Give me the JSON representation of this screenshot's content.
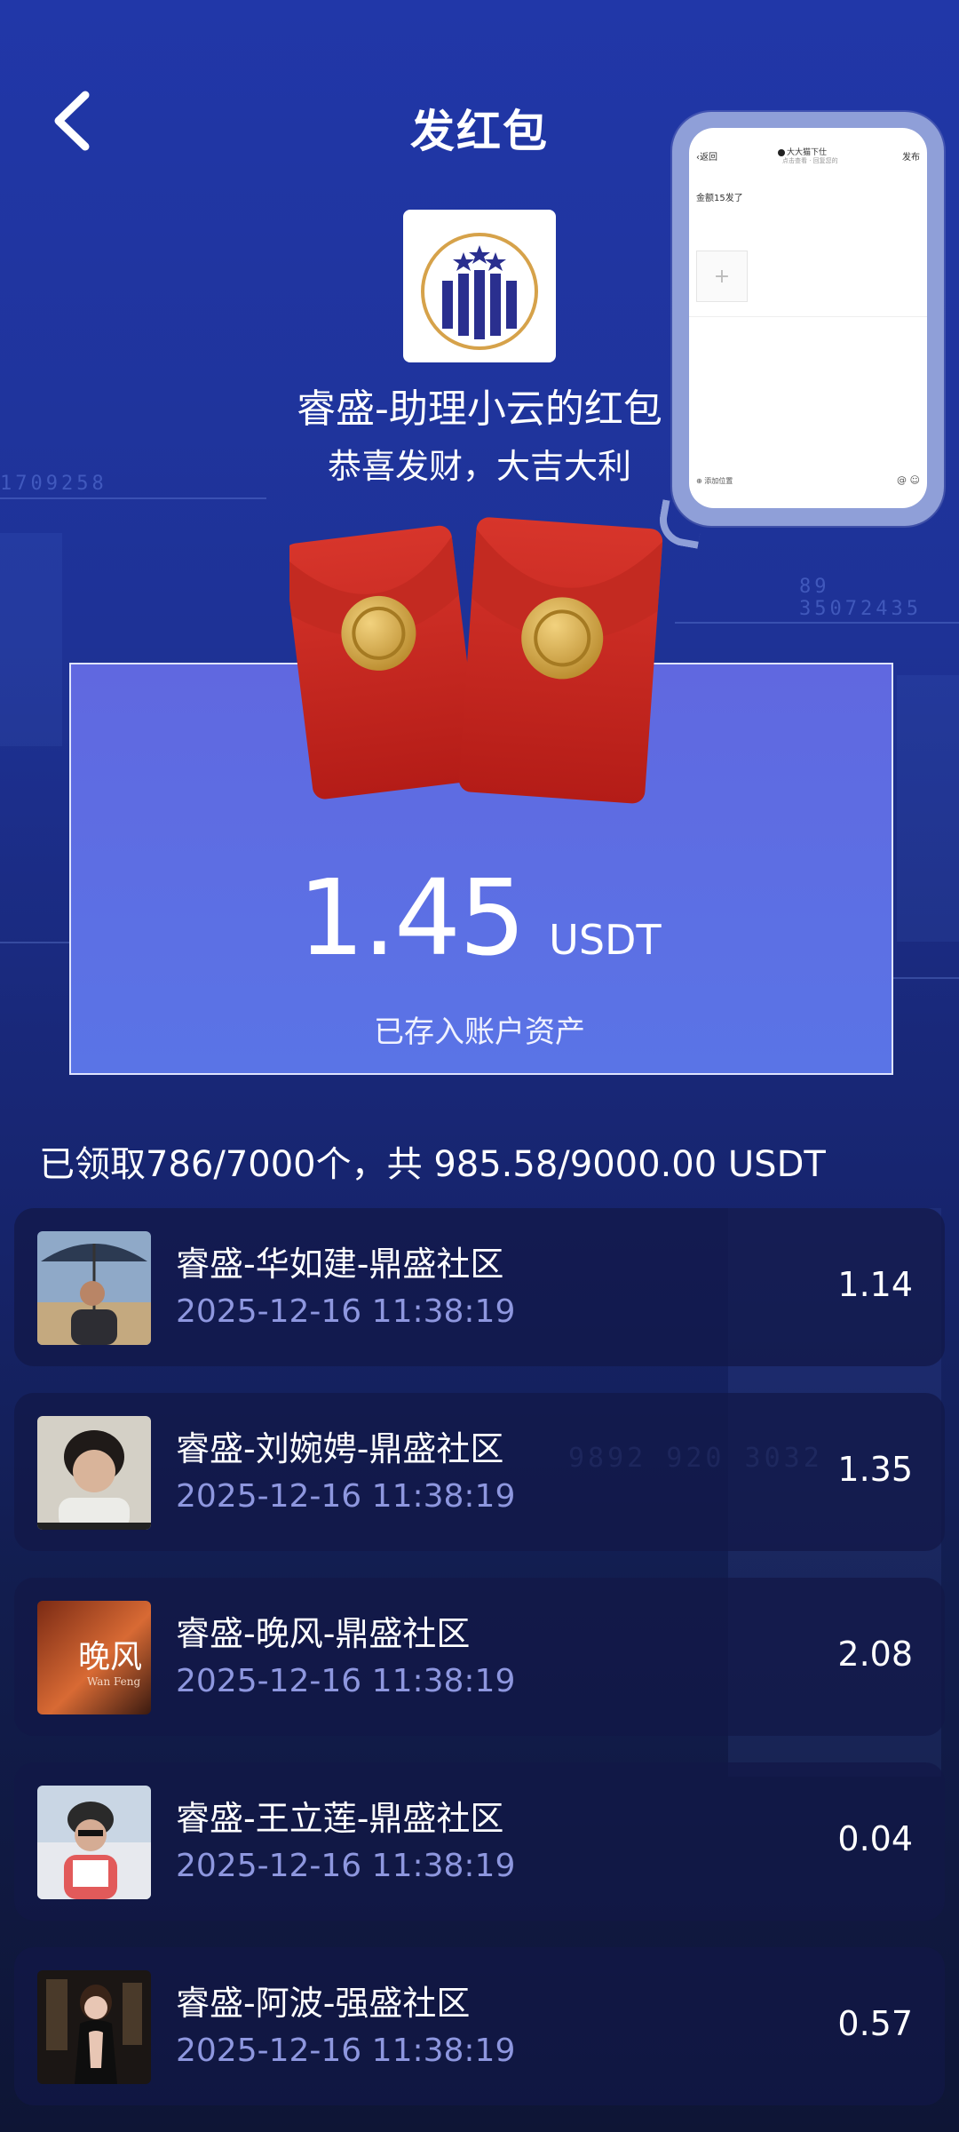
{
  "header": {
    "title": "发红包",
    "back_icon": "chevron-left-icon"
  },
  "phone_preview": {
    "back_label": "返回",
    "user_name": "大大猫下仕",
    "user_sub": "点击查看 · 回复您的",
    "publish_label": "发布",
    "post_text": "金额15发了",
    "plus_icon": "+",
    "bottom_left": "添加位置",
    "bottom_icons": "@ ☺"
  },
  "packet": {
    "sender": "睿盛-助理小云的红包",
    "greeting": "恭喜发财，大吉大利",
    "amount": "1.45",
    "unit": "USDT",
    "note": "已存入账户资产"
  },
  "summary": {
    "text": "已领取786/7000个，共 985.58/9000.00 USDT"
  },
  "receivers": [
    {
      "name": "睿盛-华如建-鼎盛社区",
      "time": "2025-12-16 11:38:19",
      "amount": "1.14"
    },
    {
      "name": "睿盛-刘婉娉-鼎盛社区",
      "time": "2025-12-16 11:38:19",
      "amount": "1.35"
    },
    {
      "name": "睿盛-晚风-鼎盛社区",
      "time": "2025-12-16 11:38:19",
      "amount": "2.08",
      "avatar_text": "晚风",
      "avatar_sub": "Wan Feng"
    },
    {
      "name": "睿盛-王立莲-鼎盛社区",
      "time": "2025-12-16 11:38:19",
      "amount": "0.04"
    },
    {
      "name": "睿盛-阿波-强盛社区",
      "time": "2025-12-16 11:38:19",
      "amount": "0.57"
    }
  ],
  "colors": {
    "accent": "#5a6fe4",
    "envelope_red": "#c8241d",
    "coin_gold": "#d9b55a",
    "time_text": "#8e97df"
  }
}
